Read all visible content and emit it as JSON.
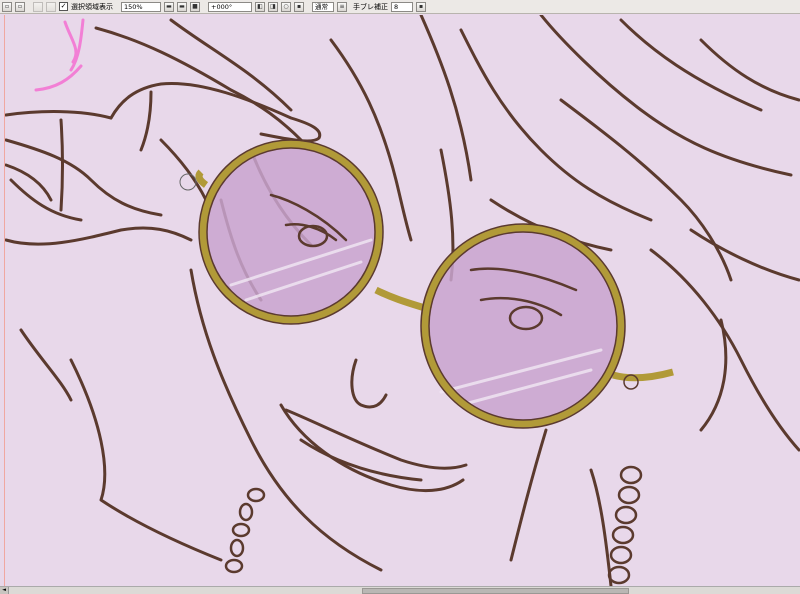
{
  "toolbar": {
    "show_selection_label": "選択領域表示",
    "show_selection_checked": "✓",
    "zoom_value": "150%",
    "rotation_value": "+000°",
    "blend_mode": "通常",
    "stabilizer_label": "手ブレ補正",
    "stabilizer_value": "8"
  },
  "icons": {
    "new": "page-icon",
    "open": "folder-icon",
    "undo": "undo-icon",
    "redo": "redo-icon",
    "zoom_out": "zoom-out-icon",
    "zoom_in": "zoom-in-icon",
    "fit": "fit-window-icon",
    "rotate_left": "rotate-left-icon",
    "rotate_right": "rotate-right-icon",
    "reset_rotation": "reset-rotation-icon",
    "flip": "flip-icon",
    "dropdown": "dropdown-icon"
  },
  "colors": {
    "canvas_bg": "#e8d8ea",
    "line_art": "#5b3a2e",
    "glasses_frame": "#b19a38",
    "lens_tint": "#c9a4cf",
    "pink_stroke": "#f27fd5"
  },
  "scrollbar": {
    "left_arrow": "◄"
  }
}
